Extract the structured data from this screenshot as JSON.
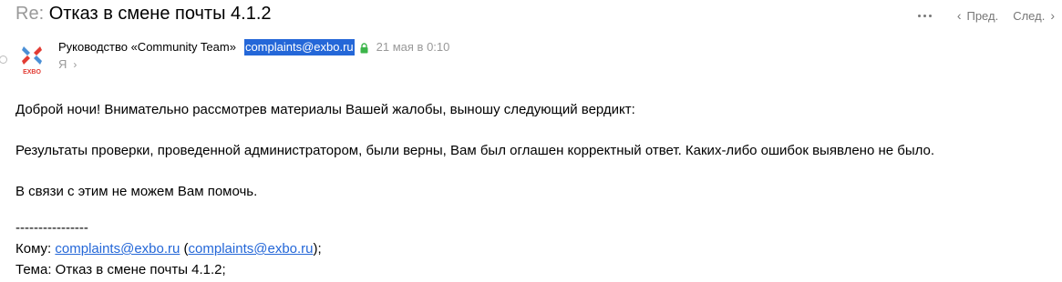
{
  "header": {
    "subject_prefix": "Re:",
    "subject": "Отказ в смене почты 4.1.2",
    "prev_label": "Пред.",
    "next_label": "След.",
    "more_icon": "more-dots-icon"
  },
  "sender": {
    "name": "Руководство «Community Team»",
    "email": "complaints@exbo.ru",
    "date": "21 мая в 0:10",
    "to_label": "Я",
    "logo_text": "EXBO",
    "lock_color": "#3cb54a"
  },
  "body": {
    "greeting": "Доброй ночи! Внимательно рассмотрев материалы Вашей жалобы, выношу следующий вердикт:",
    "result": "Результаты проверки, проведенной администратором, были верны, Вам был оглашен корректный ответ. Каких-либо ошибок выявлено не было.",
    "closing": "В связи с этим не можем Вам помочь.",
    "separator": "----------------",
    "to_prefix": "Кому: ",
    "to_email": "complaints@exbo.ru",
    "to_email_paren": "complaints@exbo.ru",
    "to_suffix": ");",
    "subject_prefix": "Тема: ",
    "subject_value": "Отказ в смене почты 4.1.2;"
  },
  "colors": {
    "link": "#2467d8",
    "muted": "#999999",
    "selection": "#2467d8"
  }
}
